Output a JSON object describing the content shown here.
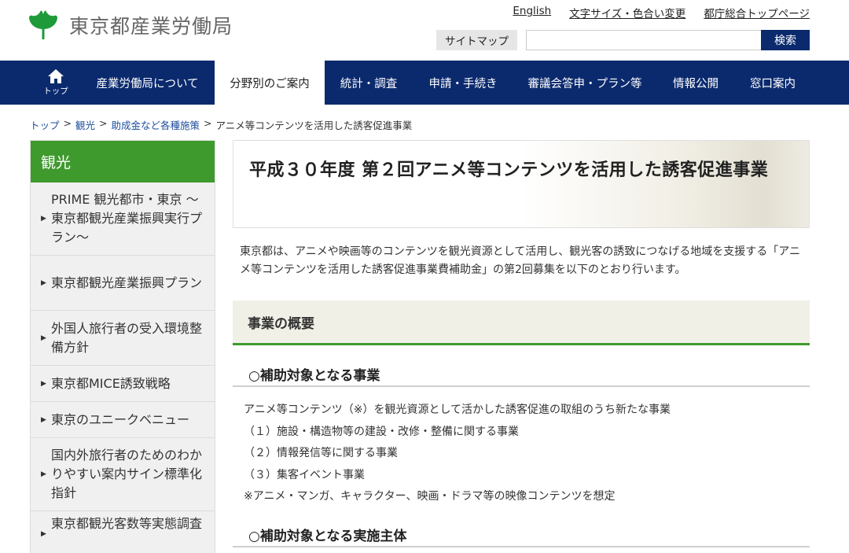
{
  "header": {
    "org_name": "東京都産業労働局",
    "util_links": [
      "English",
      "文字サイズ・色合い変更",
      "都庁総合トップページ"
    ],
    "sitemap_label": "サイトマップ",
    "search_placeholder": "",
    "search_button": "検索"
  },
  "nav": {
    "home_label": "トップ",
    "items": [
      "産業労働局について",
      "分野別のご案内",
      "統計・調査",
      "申請・手続き",
      "審議会答申・プラン等",
      "情報公開",
      "窓口案内"
    ],
    "active": "分野別のご案内"
  },
  "breadcrumb": [
    {
      "label": "トップ",
      "link": true
    },
    {
      "label": "観光",
      "link": true
    },
    {
      "label": "助成金など各種施策",
      "link": true
    },
    {
      "label": "アニメ等コンテンツを活用した誘客促進事業",
      "link": false
    }
  ],
  "sidebar": {
    "heading": "観光",
    "items": [
      {
        "label": "PRIME 観光都市・東京 ～東京都観光産業振興実行プラン～"
      },
      {
        "label": "東京都観光産業振興プラン"
      },
      {
        "label": "外国人旅行者の受入環境整備方針"
      },
      {
        "label": "東京都MICE誘致戦略"
      },
      {
        "label": "東京のユニークベニュー"
      },
      {
        "label": "国内外旅行者のためのわかりやすい案内サイン標準化指針"
      },
      {
        "label": "東京都観光客数等実態調査"
      }
    ]
  },
  "main": {
    "title": "平成３０年度 第２回アニメ等コンテンツを活用した誘客促進事業",
    "intro": "東京都は、アニメや映画等のコンテンツを観光資源として活用し、観光客の誘致につなげる地域を支援する「アニメ等コンテンツを活用した誘客促進事業費補助金」の第2回募集を以下のとおり行います。",
    "section_heading": "事業の概要",
    "subsections": [
      {
        "heading": "○補助対象となる事業",
        "lines": [
          "アニメ等コンテンツ（※）を観光資源として活かした誘客促進の取組のうち新たな事業",
          "（１）施設・構造物等の建設・改修・整備に関する事業",
          "（２）情報発信等に関する事業",
          "（３）集客イベント事業",
          "※アニメ・マンガ、キャラクター、映画・ドラマ等の映像コンテンツを想定"
        ]
      },
      {
        "heading": "○補助対象となる実施主体",
        "lines": []
      }
    ]
  },
  "colors": {
    "nav_bg": "#0b2a6e",
    "accent_green": "#3f9a2d",
    "sidebar_bg": "#f0f0f0",
    "section_bg": "#f1f0e6",
    "link_blue": "#1d4e9c"
  }
}
